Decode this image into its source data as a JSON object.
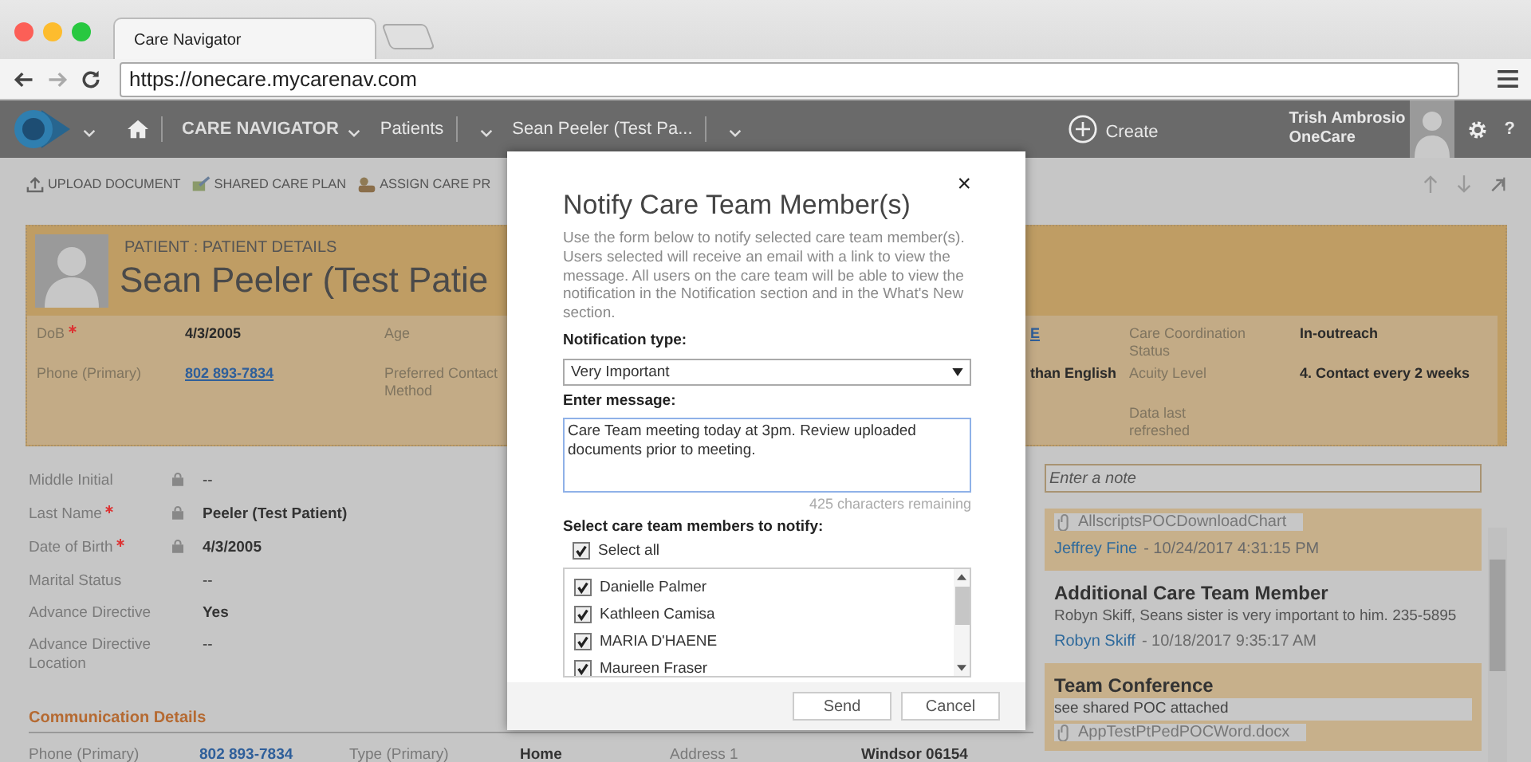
{
  "browser": {
    "tab_title": "Care Navigator",
    "url": "https://onecare.mycarenav.com"
  },
  "navbar": {
    "breadcrumbs": [
      {
        "label": "CARE NAVIGATOR",
        "strong": true
      },
      {
        "label": "Patients",
        "strong": false
      },
      {
        "label": "Sean Peeler (Test Pa...",
        "strong": false
      }
    ],
    "create": "Create",
    "user_name": "Trish Ambrosio",
    "user_org": "OneCare",
    "help": "?"
  },
  "commands": [
    {
      "label": "UPLOAD DOCUMENT",
      "kind": "upload"
    },
    {
      "label": "SHARED CARE PLAN",
      "kind": "plan"
    },
    {
      "label": "ASSIGN CARE PR",
      "kind": "assign"
    }
  ],
  "patient_header": {
    "section": "PATIENT : PATIENT DETAILS",
    "name": "Sean Peeler (Test Patie",
    "fields": [
      [
        {
          "kind": "label",
          "text": "DoB",
          "required": true
        },
        {
          "kind": "value",
          "text": "4/3/2005"
        },
        {
          "kind": "label",
          "text": "Age",
          "required": false
        },
        {
          "kind": "link",
          "text": "E"
        },
        {
          "kind": "label",
          "text": "Care Coordination Status",
          "required": false
        },
        {
          "kind": "value",
          "text": "In-outreach"
        }
      ],
      [
        {
          "kind": "label",
          "text": "Phone (Primary)",
          "required": false
        },
        {
          "kind": "link",
          "text": "802 893-7834"
        },
        {
          "kind": "label",
          "text": "Preferred Contact Method",
          "required": false
        },
        {
          "kind": "value",
          "text": "than English"
        },
        {
          "kind": "label",
          "text": "Acuity Level",
          "required": false
        },
        {
          "kind": "value",
          "text": "4. Contact every 2 weeks"
        }
      ],
      [
        {
          "kind": "empty"
        },
        {
          "kind": "empty"
        },
        {
          "kind": "empty"
        },
        {
          "kind": "empty"
        },
        {
          "kind": "label",
          "text": "Data last refreshed",
          "required": false
        },
        {
          "kind": "empty"
        }
      ]
    ]
  },
  "details": [
    {
      "label": "Middle Initial",
      "required": false,
      "locked": true,
      "value": "--",
      "bold": false
    },
    {
      "label": "Last Name",
      "required": true,
      "locked": true,
      "value": "Peeler (Test Patient)",
      "bold": true
    },
    {
      "label": "Date of Birth",
      "required": true,
      "locked": true,
      "value": "4/3/2005",
      "bold": true
    },
    {
      "label": "Marital Status",
      "required": false,
      "locked": false,
      "value": "--",
      "bold": false
    },
    {
      "label": "Advance Directive",
      "required": false,
      "locked": false,
      "value": "Yes",
      "bold": true
    },
    {
      "label": "Advance Directive Location",
      "required": false,
      "locked": false,
      "value": "--",
      "bold": false
    }
  ],
  "communication": {
    "heading": "Communication Details",
    "cells": [
      {
        "kind": "label",
        "text": "Phone (Primary)"
      },
      {
        "kind": "link",
        "text": "802 893-7834"
      },
      {
        "kind": "label",
        "text": "Type (Primary)"
      },
      {
        "kind": "value",
        "text": "Home"
      },
      {
        "kind": "label",
        "text": "Address 1"
      },
      {
        "kind": "value",
        "text": "Windsor 06154"
      }
    ]
  },
  "notes": {
    "placeholder": "Enter a note",
    "items": [
      {
        "kind": "attachment",
        "highlighted": true,
        "file": "AllscriptsPOCDownloadChart",
        "author": "Jeffrey Fine",
        "time": "- 10/24/2017 4:31:15 PM"
      },
      {
        "kind": "text",
        "highlighted": false,
        "title": "Additional Care Team Member",
        "body": "Robyn Skiff, Seans sister is very important to him. 235-5895",
        "author": "Robyn Skiff",
        "time": "- 10/18/2017 9:35:17 AM"
      },
      {
        "kind": "conference",
        "highlighted": true,
        "title": "Team Conference",
        "body": "see shared POC attached",
        "file": "AppTestPtPedPOCWord.docx"
      }
    ]
  },
  "modal": {
    "title": "Notify Care Team Member(s)",
    "close": "×",
    "description": "Use the form below to notify selected care team member(s). Users selected will receive an email with a link to view the message. All users on the care team will be able to view the notification in the Notification section and in the What's New section.",
    "type_label": "Notification type:",
    "type_value": "Very Important",
    "message_label": "Enter message:",
    "message": "Care Team meeting today at 3pm. Review uploaded documents prior to meeting.",
    "remaining": "425 characters remaining",
    "members_label": "Select care team members to notify:",
    "select_all": {
      "label": "Select all",
      "checked": true
    },
    "members": [
      {
        "name": "Danielle Palmer",
        "checked": true
      },
      {
        "name": "Kathleen Camisa",
        "checked": true
      },
      {
        "name": "MARIA D'HAENE",
        "checked": true
      },
      {
        "name": "Maureen Fraser",
        "checked": true
      }
    ],
    "buttons": [
      "Send",
      "Cancel"
    ]
  }
}
